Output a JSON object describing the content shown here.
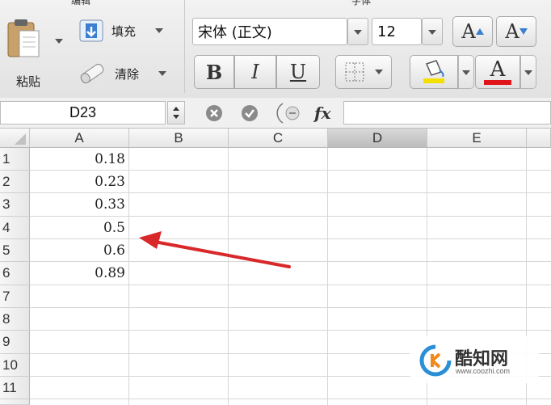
{
  "ribbon": {
    "edit_group_title": "编辑",
    "font_group_title": "字体",
    "paste_label": "粘贴",
    "fill_label": "填充",
    "clear_label": "清除",
    "font_name": "宋体 (正文)",
    "font_size": "12",
    "grow_font": "A",
    "shrink_font": "A",
    "bold": "B",
    "italic": "I",
    "underline": "U",
    "font_color_letter": "A",
    "highlight_color": "#f4e000",
    "font_color": "#e0151b"
  },
  "formula_bar": {
    "name_box": "D23",
    "fx": "fx",
    "formula": ""
  },
  "grid": {
    "columns": [
      "A",
      "B",
      "C",
      "D",
      "E"
    ],
    "selected_column": "D",
    "rows": [
      "1",
      "2",
      "3",
      "4",
      "5",
      "6",
      "7",
      "8",
      "9",
      "10",
      "11"
    ],
    "column_a_values": [
      "0.18",
      "0.23",
      "0.33",
      "0.5",
      "0.6",
      "0.89"
    ]
  },
  "annotation": {
    "arrow_color": "#d9282a"
  },
  "watermark": {
    "brand": "酷知网",
    "url": "www.coozhi.com"
  }
}
